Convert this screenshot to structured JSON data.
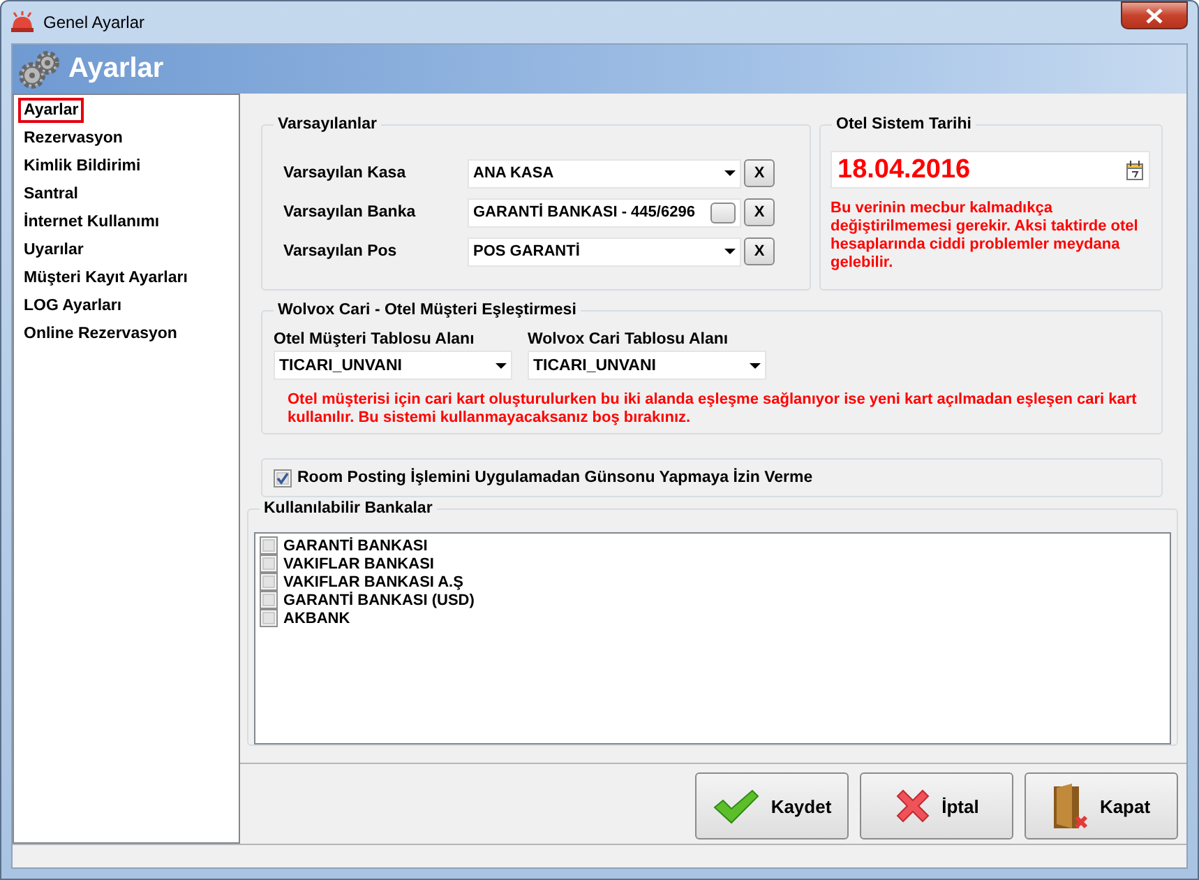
{
  "window": {
    "title": "Genel Ayarlar"
  },
  "header": {
    "title": "Ayarlar"
  },
  "sidebar": {
    "items": [
      {
        "label": "Ayarlar",
        "selected": true
      },
      {
        "label": "Rezervasyon",
        "selected": false
      },
      {
        "label": "Kimlik Bildirimi",
        "selected": false
      },
      {
        "label": "Santral",
        "selected": false
      },
      {
        "label": "İnternet Kullanımı",
        "selected": false
      },
      {
        "label": "Uyarılar",
        "selected": false
      },
      {
        "label": "Müşteri Kayıt Ayarları",
        "selected": false
      },
      {
        "label": "LOG Ayarları",
        "selected": false
      },
      {
        "label": "Online Rezervasyon",
        "selected": false
      }
    ]
  },
  "defaults": {
    "title": "Varsayılanlar",
    "rows": [
      {
        "label": "Varsayılan Kasa",
        "value": "ANA KASA",
        "kind": "dropdown",
        "clear": "X"
      },
      {
        "label": "Varsayılan Banka",
        "value": "GARANTİ BANKASI - 445/6296",
        "kind": "lookup",
        "clear": "X"
      },
      {
        "label": "Varsayılan Pos",
        "value": "POS GARANTİ",
        "kind": "dropdown",
        "clear": "X"
      }
    ]
  },
  "system_date": {
    "title": "Otel Sistem Tarihi",
    "value": "18.04.2016",
    "warning": "Bu verinin mecbur kalmadıkça değiştirilmemesi gerekir. Aksi taktirde otel hesaplarında ciddi problemler meydana gelebilir."
  },
  "matching": {
    "title": "Wolvox Cari - Otel Müşteri Eşleştirmesi",
    "fields": [
      {
        "label": "Otel Müşteri Tablosu Alanı",
        "value": "TICARI_UNVANI"
      },
      {
        "label": "Wolvox Cari Tablosu Alanı",
        "value": "TICARI_UNVANI"
      }
    ],
    "note": "Otel müşterisi için cari kart oluşturulurken bu iki alanda eşleşme sağlanıyor ise yeni kart açılmadan eşleşen cari kart kullanılır. Bu sistemi kullanmayacaksanız boş bırakınız."
  },
  "room_posting": {
    "label": "Room Posting İşlemini Uygulamadan Günsonu Yapmaya İzin Verme",
    "checked": true
  },
  "banks": {
    "title": "Kullanılabilir Bankalar",
    "items": [
      {
        "label": "GARANTİ BANKASI",
        "checked": false
      },
      {
        "label": "VAKIFLAR BANKASI",
        "checked": false
      },
      {
        "label": "VAKIFLAR BANKASI A.Ş",
        "checked": false
      },
      {
        "label": "GARANTİ BANKASI (USD)",
        "checked": false
      },
      {
        "label": "AKBANK",
        "checked": false
      }
    ]
  },
  "buttons": [
    {
      "label": "Kaydet",
      "kind": "save"
    },
    {
      "label": "İptal",
      "kind": "cancel"
    },
    {
      "label": "Kapat",
      "kind": "close"
    }
  ]
}
